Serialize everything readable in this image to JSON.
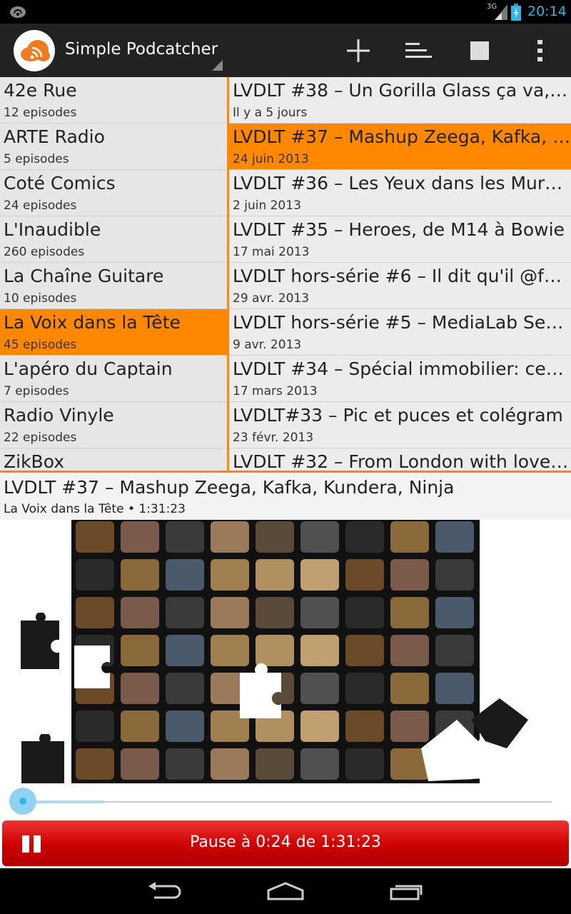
{
  "status_bar": {
    "notification_icon": "cast-icon",
    "network_type": "3G",
    "time": "20:14",
    "accent_color": "#33b5e5"
  },
  "action_bar": {
    "app_title": "Simple Podcatcher",
    "icons": [
      "add-icon",
      "sort-icon",
      "stop-icon",
      "overflow-menu-icon"
    ]
  },
  "podcasts": [
    {
      "name": "42e Rue",
      "episodes": "12 episodes",
      "selected": false
    },
    {
      "name": "ARTE Radio",
      "episodes": "5 episodes",
      "selected": false
    },
    {
      "name": "Coté Comics",
      "episodes": "24 episodes",
      "selected": false
    },
    {
      "name": "L'Inaudible",
      "episodes": "260 episodes",
      "selected": false
    },
    {
      "name": "La Chaîne Guitare",
      "episodes": "10 episodes",
      "selected": false
    },
    {
      "name": "La Voix dans la Tête",
      "episodes": "45 episodes",
      "selected": true
    },
    {
      "name": "L'apéro du Captain",
      "episodes": "7 episodes",
      "selected": false
    },
    {
      "name": "Radio Vinyle",
      "episodes": "22 episodes",
      "selected": false
    },
    {
      "name": "ZikBox",
      "episodes": "",
      "selected": false
    }
  ],
  "episodes": [
    {
      "title": "LVDLT #38 – Un Gorilla Glass ça va, d...",
      "date": "Il y a 5 jours",
      "selected": false
    },
    {
      "title": "LVDLT #37 – Mashup Zeega, Kafka, K...",
      "date": "24 juin 2013",
      "selected": true
    },
    {
      "title": "LVDLT #36 – Les Yeux dans les Murs,...",
      "date": "2 juin 2013",
      "selected": false
    },
    {
      "title": "LVDLT #35 – Heroes, de M14 à Bowie",
      "date": "17 mai 2013",
      "selected": false
    },
    {
      "title": "LVDLT hors-série #6 – Il dit qu'il @fo...",
      "date": "29 avr. 2013",
      "selected": false
    },
    {
      "title": "LVDLT hors-série #5 – MediaLab Ses...",
      "date": "9 avr. 2013",
      "selected": false
    },
    {
      "title": "LVDLT #34 – Spécial immobilier: ces ...",
      "date": "17 mars 2013",
      "selected": false
    },
    {
      "title": "LVDLT#33 – Pic et puces et colégram",
      "date": "23 févr. 2013",
      "selected": false
    },
    {
      "title": "LVDLT #32 – From London with love :...",
      "date": "",
      "selected": false
    }
  ],
  "now_playing": {
    "title": "LVDLT #37 – Mashup Zeega, Kafka, Kundera, Ninja",
    "subtitle": "La Voix dans la Tête • 1:31:23"
  },
  "player": {
    "progress_fraction": 0.005,
    "pause_label": "Pause à 0:24 de 1:31:23",
    "button_color": "#cc0000"
  },
  "colors": {
    "selection": "#ff8800",
    "actionbar_bg": "#222222"
  },
  "nav_bar": {
    "icons": [
      "back-icon",
      "home-icon",
      "recent-apps-icon"
    ]
  }
}
